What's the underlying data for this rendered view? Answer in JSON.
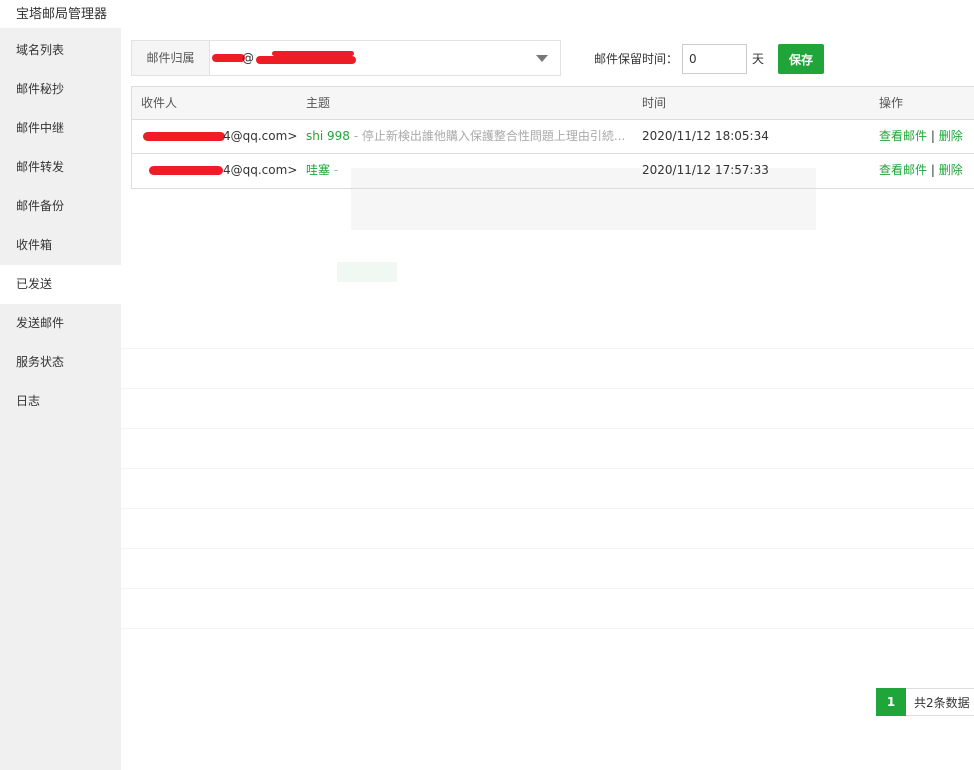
{
  "window": {
    "title": "宝塔邮局管理器"
  },
  "sidebar": {
    "items": [
      {
        "label": "域名列表"
      },
      {
        "label": "邮件秘抄"
      },
      {
        "label": "邮件中继"
      },
      {
        "label": "邮件转发"
      },
      {
        "label": "邮件备份"
      },
      {
        "label": "收件箱"
      },
      {
        "label": "已发送",
        "active": true
      },
      {
        "label": "发送邮件"
      },
      {
        "label": "服务状态"
      },
      {
        "label": "日志"
      }
    ]
  },
  "toolbar": {
    "mailbox_label": "邮件归属",
    "mailbox_value": "@",
    "retention_label": "邮件保留时间：",
    "retention_value": "0",
    "retention_unit": "天",
    "save_label": "保存"
  },
  "table": {
    "headers": {
      "recipient": "收件人",
      "subject": "主题",
      "time": "时间",
      "actions": "操作"
    },
    "rows": [
      {
        "recipient": "4@qq.com>",
        "subject": "shi 998",
        "snippet": " - 停止新検出誰他購入保護整合性問題上理由引続...",
        "time": "2020/11/12 18:05:34",
        "view": "查看邮件",
        "sep": "|",
        "delete": "删除"
      },
      {
        "recipient": "4@qq.com>",
        "subject": "哇塞",
        "snippet": " -",
        "time": "2020/11/12 17:57:33",
        "view": "查看邮件",
        "sep": "|",
        "delete": "删除"
      }
    ]
  },
  "pagination": {
    "current": "1",
    "total_text": "共2条数据"
  },
  "colors": {
    "accent": "#20a53a",
    "sidebar_bg": "#f0f0f0",
    "redaction": "#ee1c25"
  }
}
